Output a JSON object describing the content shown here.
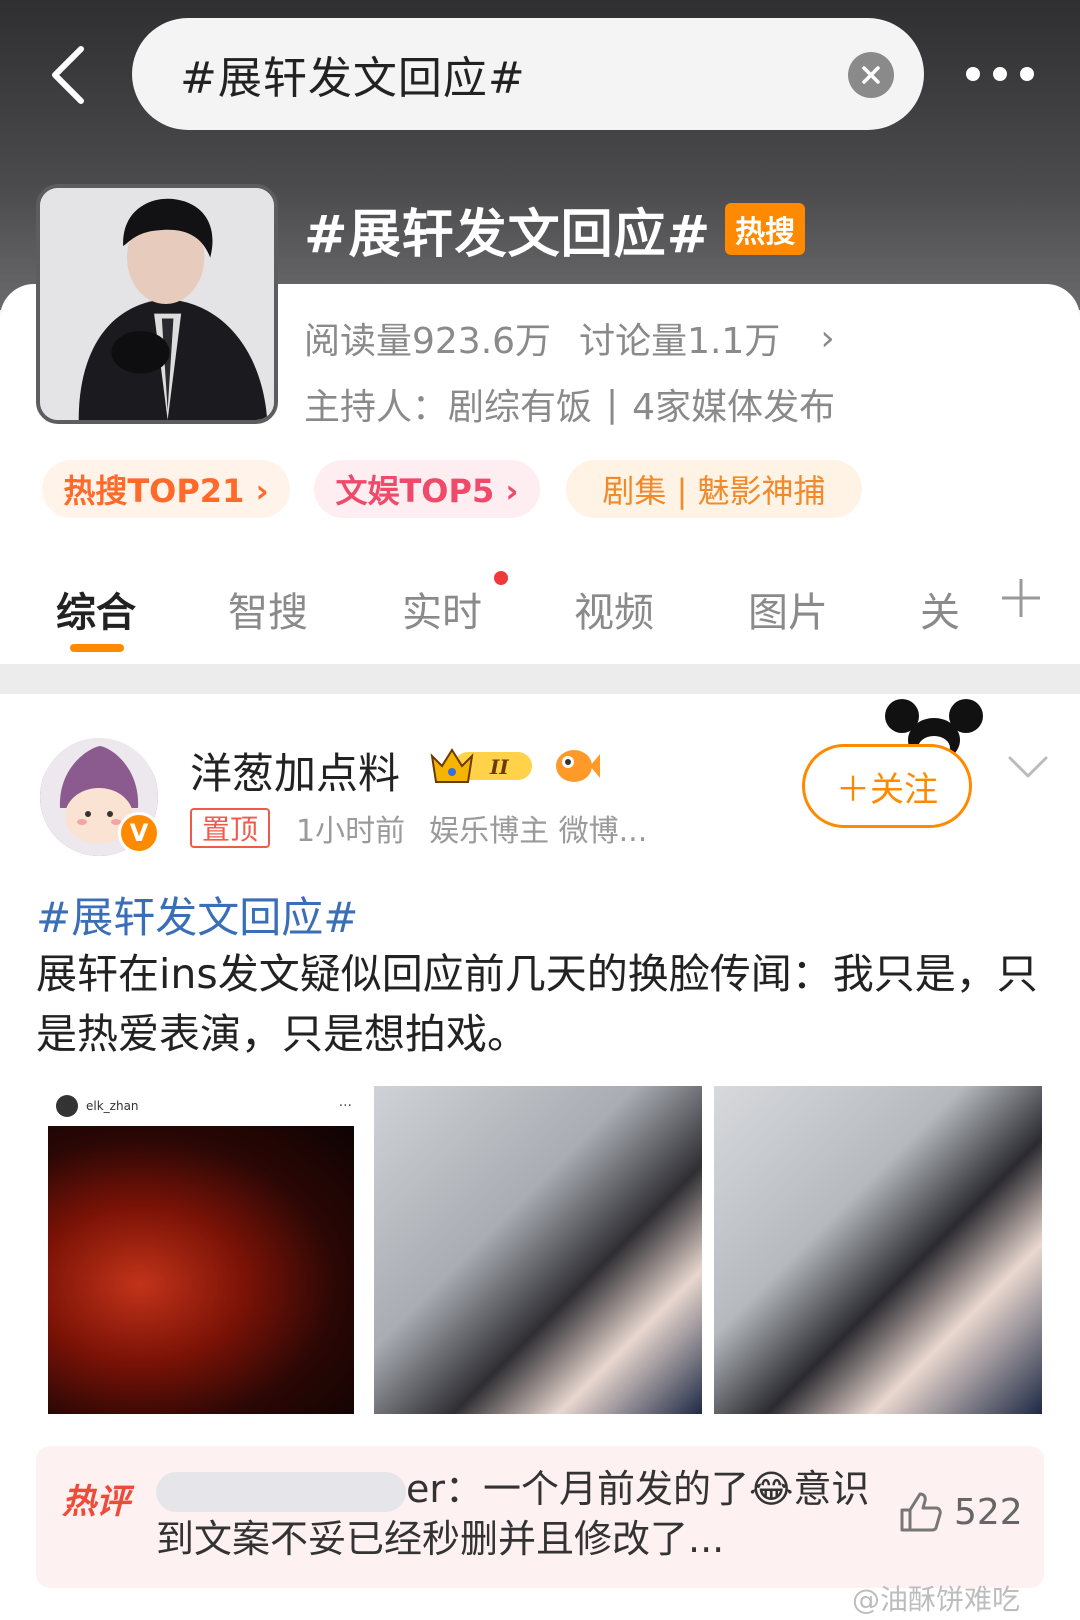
{
  "search": {
    "query": "#展轩发文回应#"
  },
  "topic": {
    "title": "#展轩发文回应#",
    "badge": "热搜",
    "reads": "阅读量923.6万",
    "discussions": "讨论量1.1万",
    "host_label": "主持人：",
    "host_name": "剧综有饭",
    "media_count": "4家媒体发布",
    "chips": [
      "热搜TOP21 ›",
      "文娱TOP5 ›",
      "剧集 | 魅影神捕"
    ]
  },
  "tabs": [
    "综合",
    "智搜",
    "实时",
    "视频",
    "图片",
    "关"
  ],
  "post": {
    "username": "洋葱加点料",
    "pin": "置顶",
    "time": "1小时前",
    "role": "娱乐博主 微博...",
    "follow": "＋关注",
    "hashtag": "#展轩发文回应#",
    "text": "展轩在ins发文疑似回应前几天的换脸传闻：我只是，只是热爱表演，只是想拍戏。",
    "ig_username": "elk_zhan"
  },
  "hot_comment": {
    "tag": "热评",
    "name_suffix": "er",
    "text": "：一个月前发的了😂意识到文案不妥已经秒删并且修改了...",
    "likes": "522"
  },
  "watermark": "@油酥饼难吃",
  "colors": {
    "accent": "#ff8a00",
    "link": "#3a6eb6",
    "hot_red": "#f04a3a"
  }
}
